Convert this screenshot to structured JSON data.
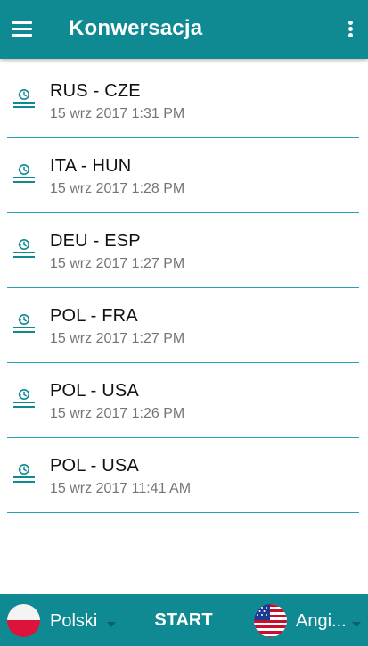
{
  "header": {
    "title": "Konwersacja",
    "menu_icon": "hamburger-menu-icon",
    "more_icon": "more-vert-icon"
  },
  "colors": {
    "primary": "#0f8a93",
    "divider": "#26a3ad",
    "icon": "#0f8a93"
  },
  "history": [
    {
      "title": "RUS - CZE",
      "date": "15 wrz 2017 1:31 PM"
    },
    {
      "title": "ITA - HUN",
      "date": "15 wrz 2017 1:28 PM"
    },
    {
      "title": "DEU - ESP",
      "date": "15 wrz 2017 1:27 PM"
    },
    {
      "title": "POL - FRA",
      "date": "15 wrz 2017 1:27 PM"
    },
    {
      "title": "POL - USA",
      "date": "15 wrz 2017 1:26 PM"
    },
    {
      "title": "POL - USA",
      "date": "15 wrz 2017 11:41 AM"
    }
  ],
  "bottom_bar": {
    "source_language": "Polski",
    "source_flag": "poland-flag-icon",
    "start_label": "START",
    "target_language": "Angi...",
    "target_flag": "usa-flag-icon"
  }
}
